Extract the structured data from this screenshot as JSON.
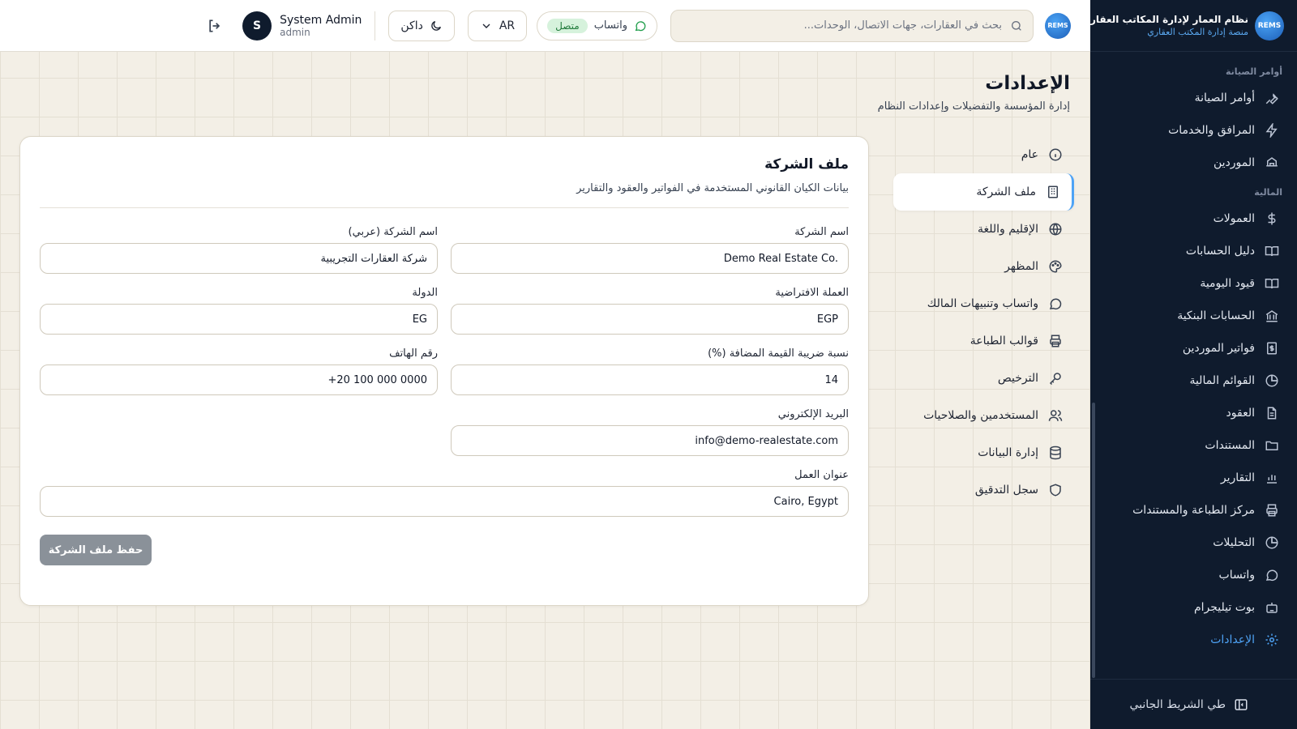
{
  "brand": {
    "logo_text": "REMS",
    "name": "نظام العمار لإدارة المكاتب العقارية",
    "subtitle": "منصة إدارة المكتب العقاري"
  },
  "topbar": {
    "logo_text": "REMS",
    "search_placeholder": "بحث في العقارات، جهات الاتصال، الوحدات...",
    "whatsapp_label": "واتساب",
    "whatsapp_status": "متصل",
    "language": "AR",
    "theme_label": "داكن",
    "user_name": "System Admin",
    "user_role": "admin",
    "avatar_initial": "S"
  },
  "sidebar": {
    "sections": [
      {
        "title": "أوامر الصيانة",
        "items": [
          {
            "label": "أوامر الصيانة",
            "icon": "wrench-icon"
          },
          {
            "label": "المرافق والخدمات",
            "icon": "bolt-icon"
          },
          {
            "label": "الموردين",
            "icon": "truck-icon"
          }
        ]
      },
      {
        "title": "المالية",
        "items": [
          {
            "label": "العمولات",
            "icon": "dollar-icon"
          },
          {
            "label": "دليل الحسابات",
            "icon": "book-icon"
          },
          {
            "label": "قيود اليومية",
            "icon": "book-open-icon"
          },
          {
            "label": "الحسابات البنكية",
            "icon": "bank-icon"
          },
          {
            "label": "فواتير الموردين",
            "icon": "invoice-icon"
          },
          {
            "label": "القوائم المالية",
            "icon": "pie-chart-icon"
          },
          {
            "label": "العقود",
            "icon": "file-text-icon"
          },
          {
            "label": "المستندات",
            "icon": "folder-icon"
          },
          {
            "label": "التقارير",
            "icon": "bar-chart-icon"
          },
          {
            "label": "مركز الطباعة والمستندات",
            "icon": "printer-icon"
          },
          {
            "label": "التحليلات",
            "icon": "analytics-icon"
          },
          {
            "label": "واتساب",
            "icon": "chat-icon"
          },
          {
            "label": "بوت تيليجرام",
            "icon": "bot-icon"
          },
          {
            "label": "الإعدادات",
            "icon": "gear-icon",
            "active": true
          }
        ]
      }
    ],
    "collapse_label": "طي الشريط الجانبي"
  },
  "page": {
    "title": "الإعدادات",
    "subtitle": "إدارة المؤسسة والتفضيلات وإعدادات النظام"
  },
  "settings_menu": [
    {
      "label": "عام",
      "icon": "info-icon"
    },
    {
      "label": "ملف الشركة",
      "icon": "building-icon",
      "active": true
    },
    {
      "label": "الإقليم واللغة",
      "icon": "globe-icon"
    },
    {
      "label": "المظهر",
      "icon": "palette-icon"
    },
    {
      "label": "واتساب وتنبيهات المالك",
      "icon": "chat-icon"
    },
    {
      "label": "قوالب الطباعة",
      "icon": "printer-icon"
    },
    {
      "label": "الترخيص",
      "icon": "key-icon"
    },
    {
      "label": "المستخدمين والصلاحيات",
      "icon": "users-icon"
    },
    {
      "label": "إدارة البيانات",
      "icon": "database-icon"
    },
    {
      "label": "سجل التدقيق",
      "icon": "shield-icon"
    }
  ],
  "company_profile": {
    "title": "ملف الشركة",
    "subtitle": "بيانات الكيان القانوني المستخدمة في الفواتير والعقود والتقارير",
    "fields": {
      "company_name": {
        "label": "اسم الشركة",
        "value": "Demo Real Estate Co."
      },
      "company_name_ar": {
        "label": "اسم الشركة (عربي)",
        "value": "شركة العقارات التجريبية"
      },
      "currency": {
        "label": "العملة الافتراضية",
        "value": "EGP"
      },
      "country": {
        "label": "الدولة",
        "value": "EG"
      },
      "vat": {
        "label": "نسبة ضريبة القيمة المضافة (%)",
        "value": "14"
      },
      "phone": {
        "label": "رقم الهاتف",
        "value": "+20 100 000 0000"
      },
      "email": {
        "label": "البريد الإلكتروني",
        "value": "info@demo-realestate.com"
      },
      "address": {
        "label": "عنوان العمل",
        "value": "Cairo, Egypt"
      }
    },
    "save_label": "حفظ ملف الشركة"
  }
}
